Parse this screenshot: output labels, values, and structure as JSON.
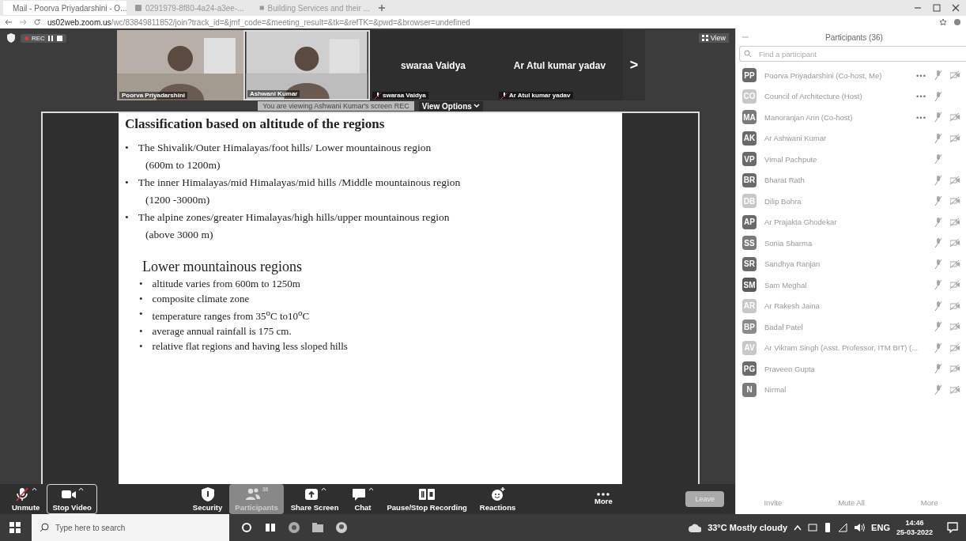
{
  "browser": {
    "tabs": [
      {
        "title": "Mail - Poorva Priyadarshini - O...",
        "selected": true
      },
      {
        "title": "0291979-8f80-4a24-a3ee-...",
        "selected": false
      },
      {
        "title": "Building Services and their ...",
        "selected": false
      }
    ],
    "url_host": "us02web.zoom.us",
    "url_path": "/wc/83849811852/join?track_id=&jmf_code=&meeting_result=&tk=&refTK=&pwd=&browser=undefined"
  },
  "meeting": {
    "recording": {
      "label": "REC",
      "paused": false
    },
    "view_button": "View",
    "videos": [
      {
        "name": "Poorva Priyadarshini",
        "kind": "camera",
        "muted": false,
        "active": false
      },
      {
        "name": "Ashwani Kumar",
        "kind": "camera",
        "muted": false,
        "active": true
      },
      {
        "name": "swaraa Vaidya",
        "display_name": "swaraa Vaidya",
        "kind": "name",
        "muted": true,
        "active": false
      },
      {
        "name": "Ar Atul kumar yadav",
        "display_name": "Ar Atul kumar yadav",
        "kind": "name",
        "muted": true,
        "active": false
      }
    ],
    "next_arrow": ">",
    "share_banner": "You are viewing Ashwani Kumar's screen",
    "banner_rec": "REC",
    "view_options": "View Options",
    "slide": {
      "title": "Classification based on altitude of the regions",
      "bullets": [
        {
          "marker": "•",
          "text": "The Shivalik/Outer Himalayas/foot hills/ Lower mountainous region",
          "note": "(600m to 1200m)"
        },
        {
          "marker": "•",
          "text": "The inner Himalayas/mid Himalayas/mid hills /Middle mountainous region",
          "note": "(1200 -3000m)"
        },
        {
          "marker": "•",
          "text": "The alpine zones/greater Himalayas/high hills/upper mountainous region",
          "note": "(above 3000 m)"
        }
      ],
      "subheading": "Lower mountainous regions",
      "points": [
        {
          "marker": "•",
          "text": "altitude varies from 600m to 1250m"
        },
        {
          "marker": "•",
          "text": "composite climate zone"
        },
        {
          "marker": "•",
          "text": "temperature ranges from  35$^{o}$C to10$^{o}$C"
        },
        {
          "marker": "•",
          "text": "average annual rainfall is 175 cm."
        },
        {
          "marker": "•",
          "text": "relative flat regions and having less sloped hills"
        }
      ]
    },
    "toolbar": [
      {
        "kind": "mic",
        "label": "Unmute",
        "caret": true,
        "selected": false
      },
      {
        "kind": "video",
        "label": "Stop Video",
        "caret": true,
        "selected": false
      },
      {
        "kind": "shield",
        "label": "Security",
        "caret": false,
        "selected": false
      },
      {
        "kind": "people",
        "label": "Participants",
        "count": "36",
        "caret": false,
        "selected": true
      },
      {
        "kind": "share",
        "label": "Share Screen",
        "caret": true,
        "selected": false
      },
      {
        "kind": "chat",
        "label": "Chat",
        "caret": true,
        "selected": false
      },
      {
        "kind": "record",
        "label": "Pause/Stop Recording",
        "caret": false,
        "selected": false
      },
      {
        "kind": "reaction",
        "label": "Reactions",
        "caret": false,
        "selected": false
      },
      {
        "kind": "more",
        "label": "More",
        "caret": false,
        "selected": false
      }
    ],
    "leave": "Leave"
  },
  "participants": {
    "title": "Participants (36)",
    "search": {
      "placeholder": "Find a participant"
    },
    "items": [
      {
        "initials": "PP",
        "name": "Poorva Priyadarshini (Co-host, Me)",
        "color": "#6a6a6a",
        "more": "•••",
        "video": true
      },
      {
        "initials": "CO",
        "name": "Council of Architecture (Host)",
        "color": "#c8c8c8",
        "more": "•••",
        "video": false
      },
      {
        "initials": "MA",
        "name": "Manoranjan Ann (Co-host)",
        "color": "#7a7a7a",
        "more": "•••",
        "video": true
      },
      {
        "initials": "AK",
        "name": "Ar Ashwani Kumar",
        "color": "#6a6a6a",
        "video": true
      },
      {
        "initials": "VP",
        "name": "Vimal Pachpute",
        "color": "#6a6a6a",
        "video": false
      },
      {
        "initials": "BR",
        "name": "Bharat Rath",
        "color": "#6a6a6a",
        "video": true
      },
      {
        "initials": "DB",
        "name": "Dilip Bohra",
        "color": "#c8c8c8",
        "video": true
      },
      {
        "initials": "AP",
        "name": "Ar Prajakta Ghodekar",
        "color": "#6a6a6a",
        "video": true
      },
      {
        "initials": "SS",
        "name": "Sonia Sharma",
        "color": "#7a7a7a",
        "video": true
      },
      {
        "initials": "SR",
        "name": "Sandhya Ranjan",
        "color": "#6a6a6a",
        "video": true
      },
      {
        "initials": "SM",
        "name": "Sam Meghal",
        "color": "#5a5a5a",
        "video": true
      },
      {
        "initials": "AR",
        "name": "Ar Rakesh Jaina",
        "color": "#c8c8c8",
        "video": true
      },
      {
        "initials": "BP",
        "name": "Badal Patel",
        "color": "#8a8a8a",
        "video": true
      },
      {
        "initials": "AV",
        "name": "Ar Vikram Singh (Asst. Professor, ITM BIT) (...",
        "color": "#c8c8c8",
        "video": true
      },
      {
        "initials": "PG",
        "name": "Praveen Gupta",
        "color": "#6a6a6a",
        "video": true
      },
      {
        "initials": "N",
        "name": "Nirmal",
        "color": "#7a7a7a",
        "video": true
      }
    ],
    "footer": [
      "Invite",
      "Mute All",
      "More"
    ]
  },
  "taskbar": {
    "search": {
      "placeholder": "Type here to search"
    },
    "weather": "33°C Mostly cloudy",
    "language": "ENG",
    "time": "14:46",
    "date": "25-03-2022"
  }
}
